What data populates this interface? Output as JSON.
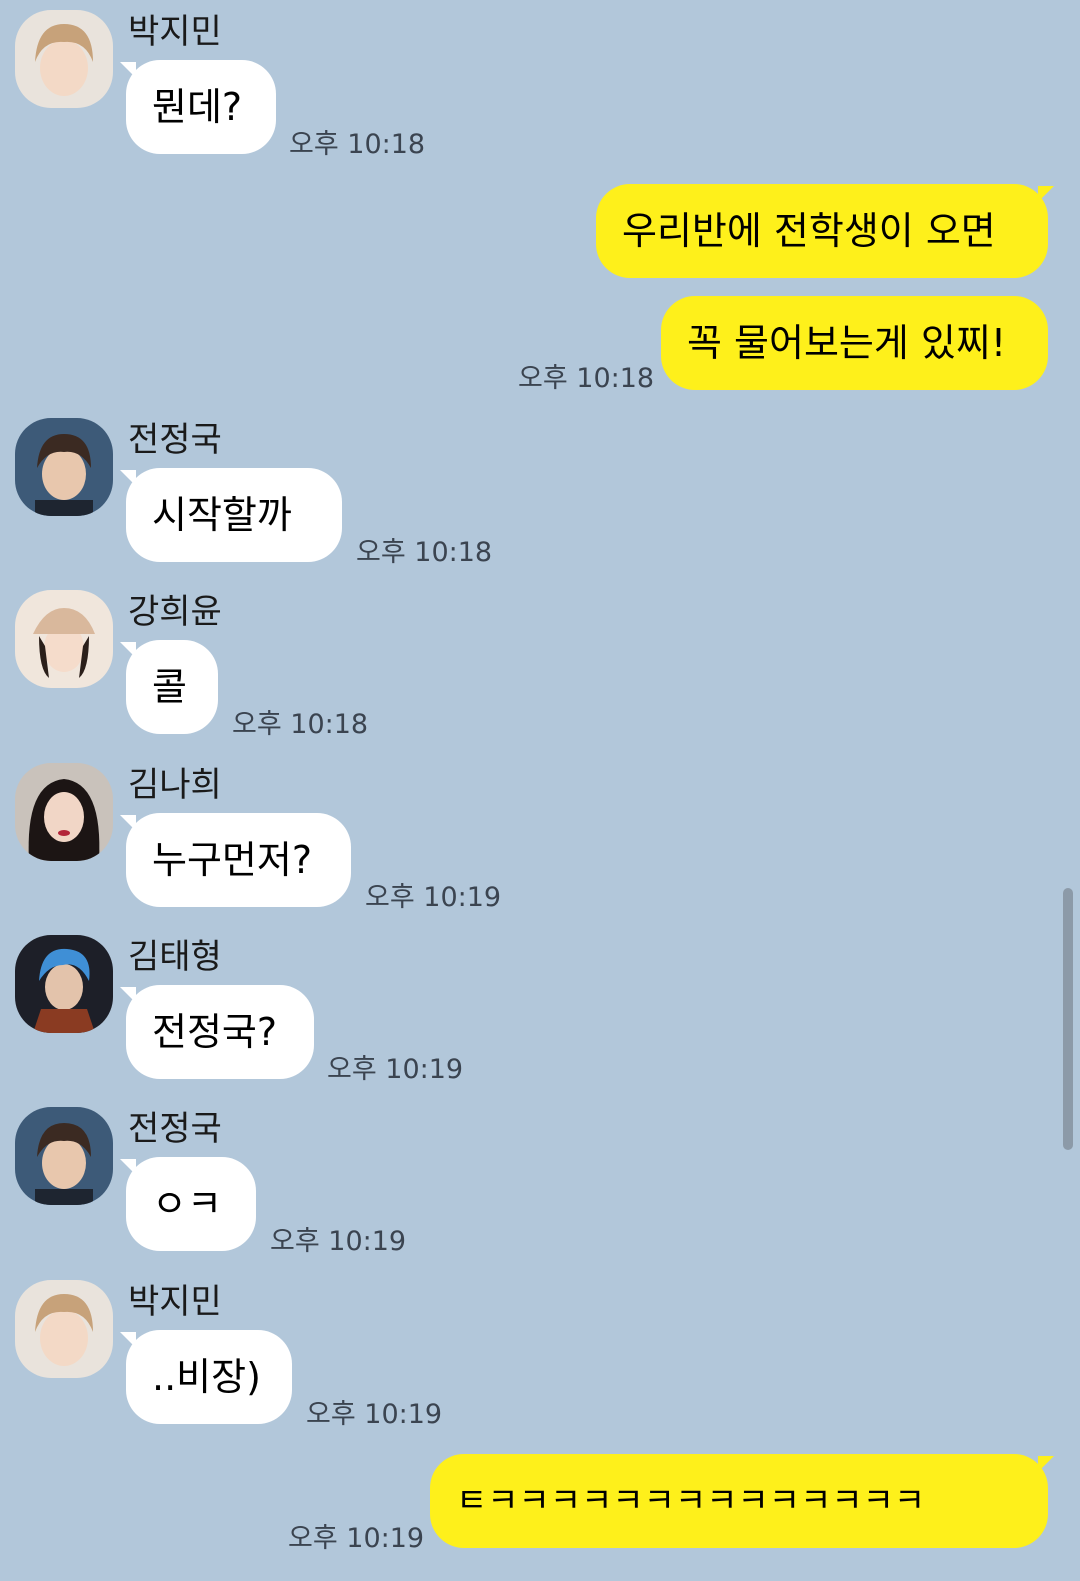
{
  "messages": [
    {
      "sender": "박지민",
      "text": "뭔데?",
      "time": "오후 10:18"
    },
    {
      "text": "우리반에 전학생이 오면"
    },
    {
      "text": "꼭 물어보는게 있찌!",
      "time": "오후 10:18"
    },
    {
      "sender": "전정국",
      "text": "시작할까",
      "time": "오후 10:18"
    },
    {
      "sender": "강희윤",
      "text": "콜",
      "time": "오후 10:18"
    },
    {
      "sender": "김나희",
      "text": "누구먼저?",
      "time": "오후 10:19"
    },
    {
      "sender": "김태형",
      "text": "전정국?",
      "time": "오후 10:19"
    },
    {
      "sender": "전정국",
      "text": "ㅇㅋ",
      "time": "오후 10:19"
    },
    {
      "sender": "박지민",
      "text": "..비장)",
      "time": "오후 10:19"
    },
    {
      "text": "ㅌㅋㅋㅋㅋㅋㅋㅋㅋㅋㅋㅋㅋㅋㅋ",
      "time": "오후 10:19"
    }
  ],
  "colors": {
    "background": "#b2c7da",
    "incoming_bubble": "#ffffff",
    "outgoing_bubble": "#fef01b"
  }
}
